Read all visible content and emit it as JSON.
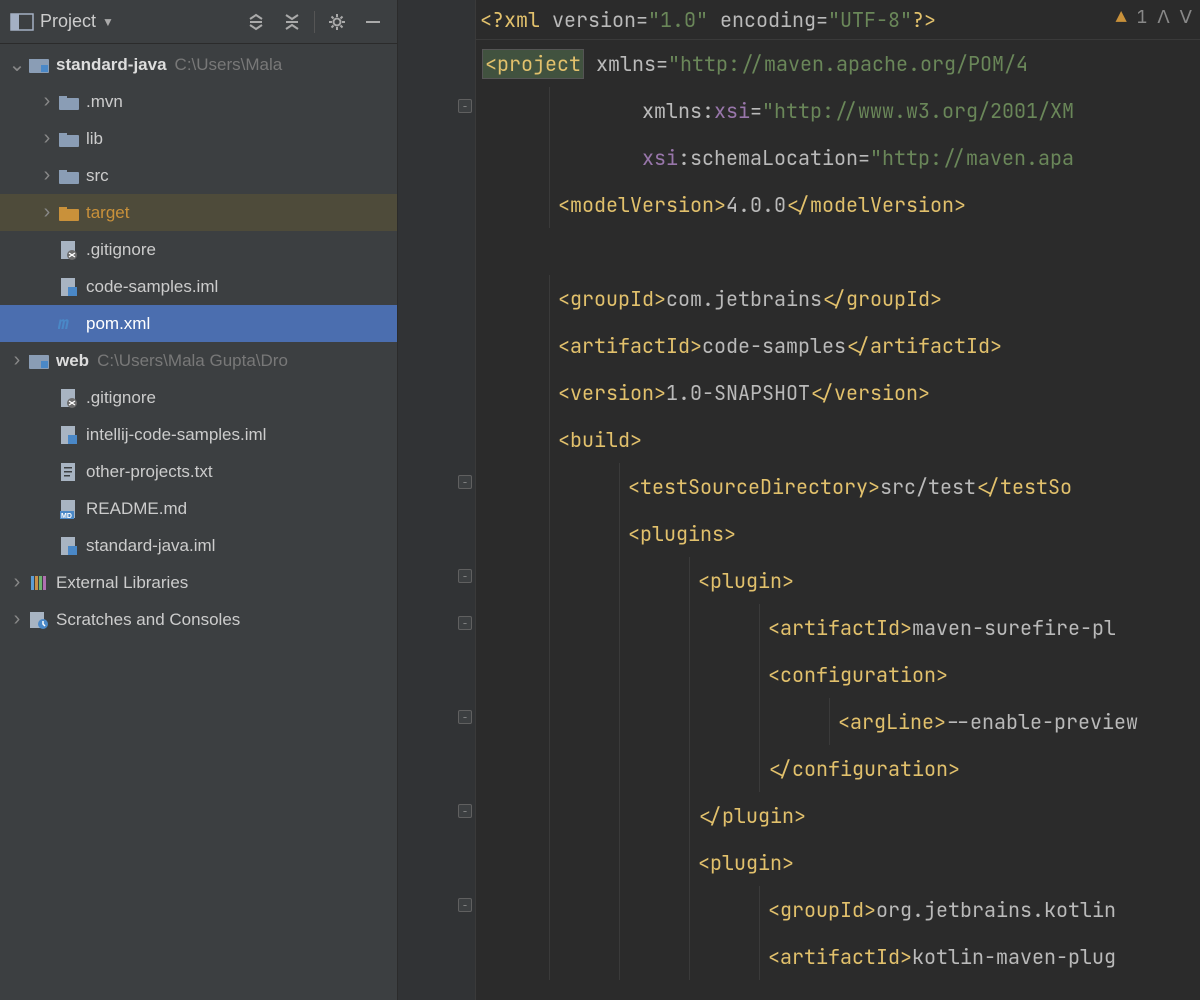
{
  "sidebar": {
    "title": "Project",
    "tree": [
      {
        "depth": 0,
        "chev": "down",
        "icon": "module",
        "label": "standard-java",
        "bold": true,
        "path": "C:\\Users\\Mala"
      },
      {
        "depth": 1,
        "chev": "right",
        "icon": "folder",
        "label": ".mvn"
      },
      {
        "depth": 1,
        "chev": "right",
        "icon": "folder",
        "label": "lib"
      },
      {
        "depth": 1,
        "chev": "right",
        "icon": "folder",
        "label": "src"
      },
      {
        "depth": 1,
        "chev": "right",
        "icon": "folder-orange",
        "label": "target",
        "orange": true,
        "highlighted": true
      },
      {
        "depth": 1,
        "chev": "",
        "icon": "file-git",
        "label": ".gitignore"
      },
      {
        "depth": 1,
        "chev": "",
        "icon": "file-iml",
        "label": "code-samples.iml"
      },
      {
        "depth": 1,
        "chev": "",
        "icon": "file-maven",
        "label": "pom.xml",
        "selected": true
      },
      {
        "depth": 0,
        "chev": "right",
        "icon": "module",
        "label": "web",
        "bold": true,
        "path": "C:\\Users\\Mala Gupta\\Dro"
      },
      {
        "depth": 0,
        "chev": "",
        "icon": "file-git",
        "label": ".gitignore",
        "indent": 1
      },
      {
        "depth": 0,
        "chev": "",
        "icon": "file-iml",
        "label": "intellij-code-samples.iml",
        "indent": 1
      },
      {
        "depth": 0,
        "chev": "",
        "icon": "file-txt",
        "label": "other-projects.txt",
        "indent": 1
      },
      {
        "depth": 0,
        "chev": "",
        "icon": "file-md",
        "label": "README.md",
        "indent": 1
      },
      {
        "depth": 0,
        "chev": "",
        "icon": "file-iml",
        "label": "standard-java.iml",
        "indent": 1
      },
      {
        "depth": 0,
        "chev": "right",
        "icon": "lib",
        "label": "External Libraries"
      },
      {
        "depth": 0,
        "chev": "right",
        "icon": "scratch",
        "label": "Scratches and Consoles"
      }
    ]
  },
  "editor": {
    "warning_count": "1",
    "lines": [
      {
        "top": true,
        "tokens": [
          [
            "pi",
            "<?"
          ],
          [
            "tag",
            "xml "
          ],
          [
            "attr",
            "version"
          ],
          [
            "attr",
            "="
          ],
          [
            "str",
            "\"1.0\" "
          ],
          [
            "attr",
            "encoding"
          ],
          [
            "attr",
            "="
          ],
          [
            "str",
            "\"UTF-8\""
          ],
          [
            "pi",
            "?>"
          ]
        ]
      },
      {
        "hlproj": true,
        "tokens": [
          [
            "tag",
            "<project "
          ],
          [
            "attr",
            "xmlns"
          ],
          [
            "attr",
            "="
          ],
          [
            "str",
            "\"http://maven.apache.org/POM/4"
          ]
        ]
      },
      {
        "indent": 1,
        "tokens": [
          [
            "attr",
            "       xmlns:"
          ],
          [
            "ns",
            "xsi"
          ],
          [
            "attr",
            "="
          ],
          [
            "str",
            "\"http://www.w3.org/2001/XM"
          ]
        ]
      },
      {
        "indent": 1,
        "tokens": [
          [
            "ns",
            "       xsi"
          ],
          [
            "attr",
            ":schemaLocation"
          ],
          [
            "attr",
            "="
          ],
          [
            "str",
            "\"http://maven.apa"
          ]
        ]
      },
      {
        "indent": 1,
        "tokens": [
          [
            "tag",
            "<modelVersion>"
          ],
          [
            "text",
            "4.0.0"
          ],
          [
            "tag",
            "</modelVersion>"
          ]
        ]
      },
      {
        "indent": 0,
        "tokens": [
          [
            "",
            ""
          ]
        ]
      },
      {
        "indent": 1,
        "tokens": [
          [
            "tag",
            "<groupId>"
          ],
          [
            "text",
            "com.jetbrains"
          ],
          [
            "tag",
            "</groupId>"
          ]
        ]
      },
      {
        "indent": 1,
        "tokens": [
          [
            "tag",
            "<artifactId>"
          ],
          [
            "text",
            "code-samples"
          ],
          [
            "tag",
            "</artifactId>"
          ]
        ]
      },
      {
        "indent": 1,
        "tokens": [
          [
            "tag",
            "<version>"
          ],
          [
            "text",
            "1.0-SNAPSHOT"
          ],
          [
            "tag",
            "</version>"
          ]
        ]
      },
      {
        "indent": 1,
        "tokens": [
          [
            "tag",
            "<build>"
          ]
        ]
      },
      {
        "indent": 2,
        "tokens": [
          [
            "tag",
            "<testSourceDirectory>"
          ],
          [
            "text",
            "src/test"
          ],
          [
            "tag",
            "</testSo"
          ]
        ]
      },
      {
        "indent": 2,
        "tokens": [
          [
            "tag",
            "<plugins>"
          ]
        ]
      },
      {
        "indent": 3,
        "tokens": [
          [
            "tag",
            "<plugin>"
          ]
        ]
      },
      {
        "indent": 4,
        "tokens": [
          [
            "tag",
            "<artifactId>"
          ],
          [
            "text",
            "maven-surefire-pl"
          ]
        ]
      },
      {
        "indent": 4,
        "tokens": [
          [
            "tag",
            "<configuration>"
          ]
        ]
      },
      {
        "indent": 5,
        "tokens": [
          [
            "tag",
            "<argLine>"
          ],
          [
            "text",
            "--enable-preview"
          ]
        ]
      },
      {
        "indent": 4,
        "tokens": [
          [
            "tag",
            "</configuration>"
          ]
        ]
      },
      {
        "indent": 3,
        "tokens": [
          [
            "tag",
            "</plugin>"
          ]
        ]
      },
      {
        "indent": 3,
        "tokens": [
          [
            "tag",
            "<plugin>"
          ]
        ]
      },
      {
        "indent": 4,
        "tokens": [
          [
            "tag",
            "<groupId>"
          ],
          [
            "text",
            "org.jetbrains.kotlin"
          ]
        ]
      },
      {
        "indent": 4,
        "tokens": [
          [
            "tag",
            "<artifactId>"
          ],
          [
            "text",
            "kotlin-maven-plug"
          ]
        ]
      }
    ],
    "fold_markers": [
      1,
      9,
      11,
      12,
      14,
      16,
      18
    ]
  }
}
